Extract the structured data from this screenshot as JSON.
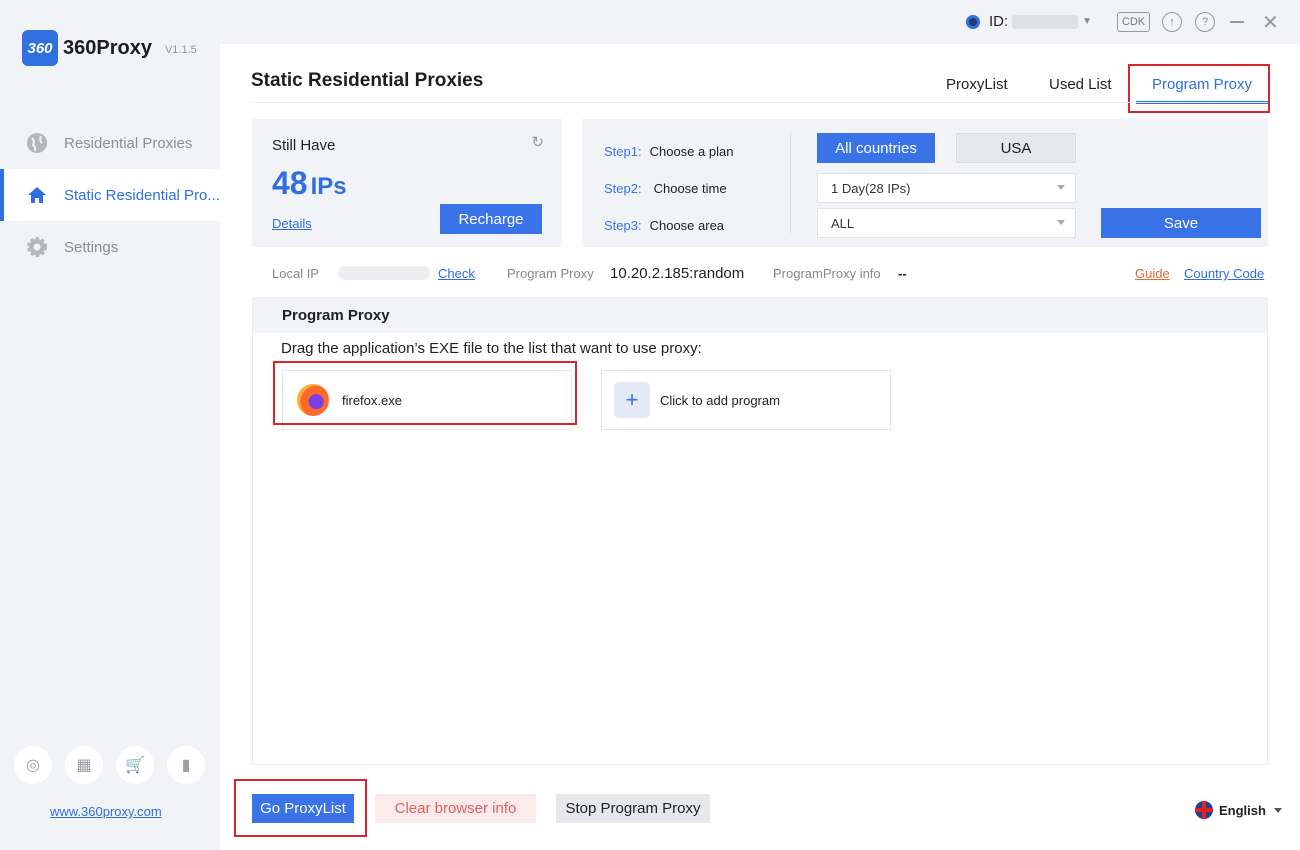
{
  "app": {
    "name": "360Proxy",
    "mark": "360",
    "version": "V1.1.5",
    "website": "www.360proxy.com"
  },
  "sidebar": {
    "items": [
      {
        "label": "Residential Proxies",
        "icon": "globe-icon"
      },
      {
        "label": "Static Residential Pro...",
        "icon": "home-icon"
      },
      {
        "label": "Settings",
        "icon": "gear-icon"
      }
    ],
    "bottom_icons": [
      "support-icon",
      "briefcase-icon",
      "cart-icon",
      "book-icon"
    ]
  },
  "titlebar": {
    "id_label": "ID:",
    "cdk_label": "CDK"
  },
  "page": {
    "title": "Static Residential Proxies",
    "tabs": [
      "ProxyList",
      "Used List",
      "Program Proxy"
    ],
    "active_tab": "Program Proxy"
  },
  "balance": {
    "label": "Still Have",
    "count": "48",
    "unit": "IPs",
    "details_label": "Details",
    "recharge_label": "Recharge"
  },
  "steps": [
    {
      "key": "Step1:",
      "label": "Choose a plan"
    },
    {
      "key": "Step2:",
      "label": "Choose time"
    },
    {
      "key": "Step3:",
      "label": "Choose area"
    }
  ],
  "plan": {
    "options": [
      "All countries",
      "USA"
    ],
    "selected": "All countries"
  },
  "time_select": {
    "value": "1 Day(28 IPs)"
  },
  "area_select": {
    "value": "ALL"
  },
  "save_label": "Save",
  "info": {
    "local_ip_label": "Local IP",
    "check_label": "Check",
    "program_proxy_label": "Program Proxy",
    "program_proxy_value": "10.20.2.185:random",
    "pp_info_label": "ProgramProxy info",
    "pp_info_value": "--",
    "guide_label": "Guide",
    "country_code_label": "Country Code"
  },
  "program_proxy": {
    "header": "Program Proxy",
    "instruction": "Drag the application’s EXE file to the list that want to use proxy:",
    "programs": [
      {
        "name": "firefox.exe",
        "icon": "firefox-icon"
      }
    ],
    "add_label": "Click to add program"
  },
  "footer": {
    "go_label": "Go ProxyList",
    "clear_label": "Clear browser info",
    "stop_label": "Stop Program Proxy",
    "language": "English"
  },
  "colors": {
    "accent": "#3a73e8",
    "highlight_box": "#d9252e",
    "guide": "#e06a3a"
  }
}
